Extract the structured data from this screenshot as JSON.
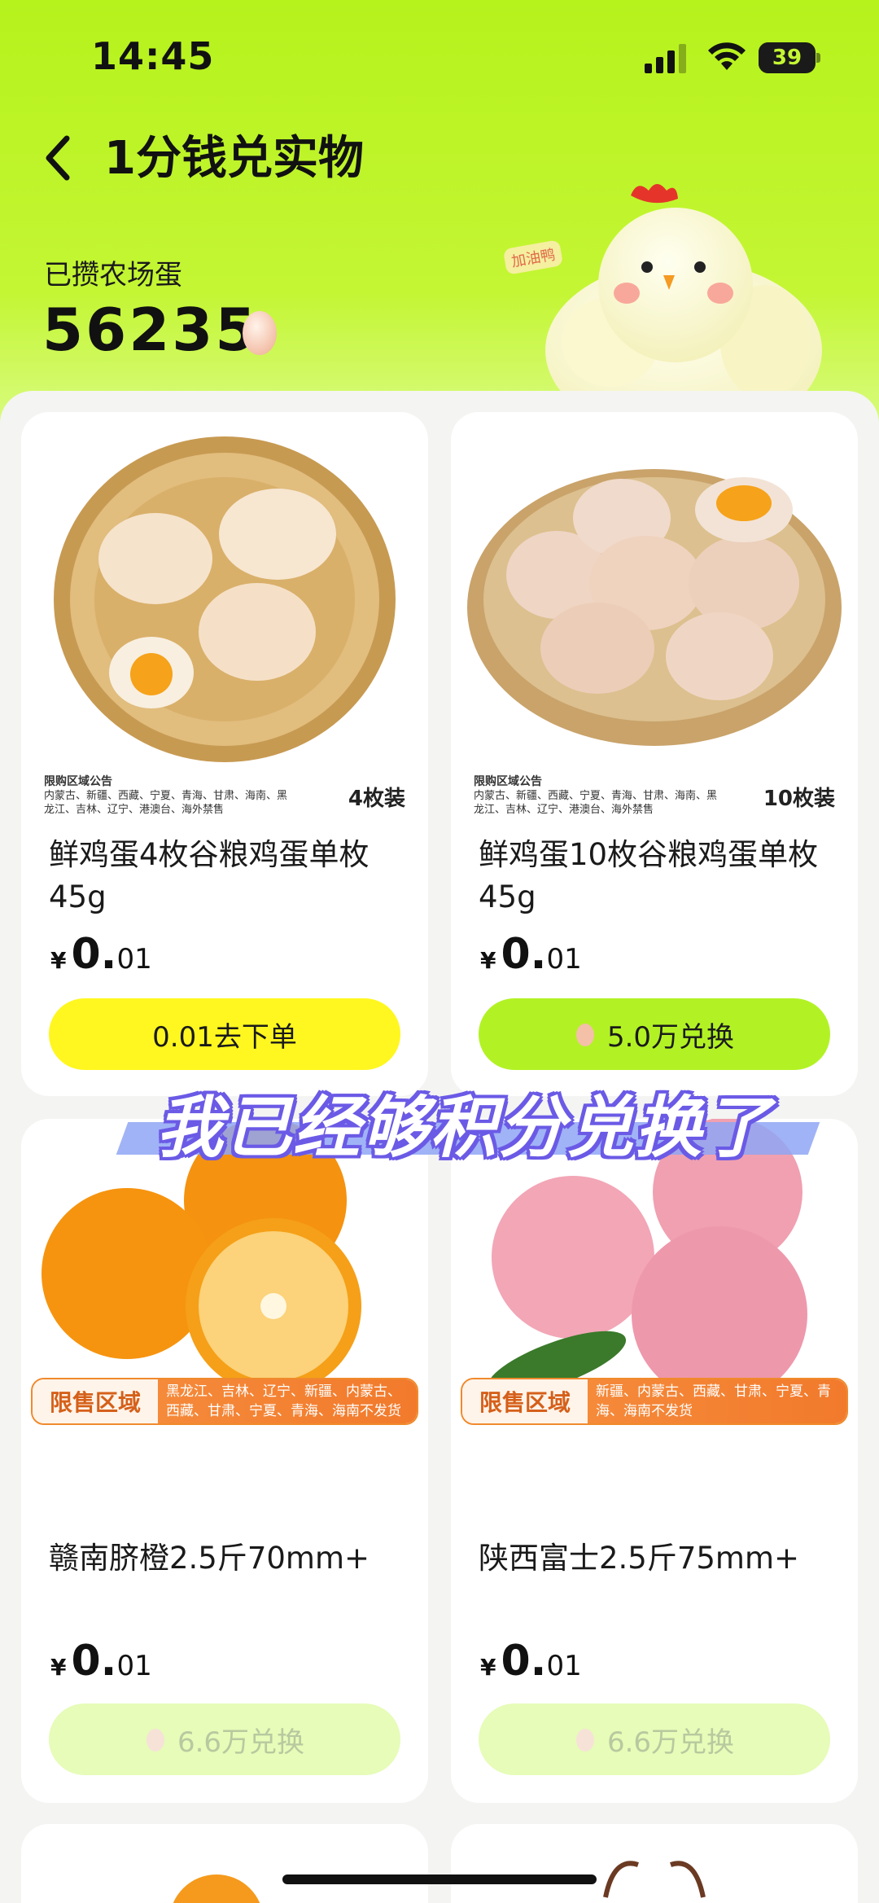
{
  "status_bar": {
    "time": "14:45",
    "battery": "39"
  },
  "header": {
    "title": "1分钱兑实物",
    "points_label": "已攒农场蛋",
    "points_value": "56235",
    "mascot_badge": "加油鸭"
  },
  "caption": "我已经够积分兑换了",
  "products": [
    {
      "name": "鲜鸡蛋4枚谷粮鸡蛋单枚45g",
      "price_symbol": "¥",
      "price_int": "0",
      "price_dot": ".",
      "price_dec": "01",
      "button": "0.01去下单",
      "pack": "4枚装",
      "notice_title": "限购区域公告",
      "notice_text": "内蒙古、新疆、西藏、宁夏、青海、甘肃、海南、黑龙江、吉林、辽宁、港澳台、海外禁售"
    },
    {
      "name": "鲜鸡蛋10枚谷粮鸡蛋单枚45g",
      "price_symbol": "¥",
      "price_int": "0",
      "price_dot": ".",
      "price_dec": "01",
      "button": "5.0万兑换",
      "pack": "10枚装",
      "notice_title": "限购区域公告",
      "notice_text": "内蒙古、新疆、西藏、宁夏、青海、甘肃、海南、黑龙江、吉林、辽宁、港澳台、海外禁售"
    },
    {
      "name": "赣南脐橙2.5斤70mm+",
      "price_symbol": "¥",
      "price_int": "0",
      "price_dot": ".",
      "price_dec": "01",
      "button": "6.6万兑换",
      "region_label": "限售区域",
      "region_text": "黑龙江、吉林、辽宁、新疆、内蒙古、西藏、甘肃、宁夏、青海、海南不发货"
    },
    {
      "name": "陕西富士2.5斤75mm+",
      "price_symbol": "¥",
      "price_int": "0",
      "price_dot": ".",
      "price_dec": "01",
      "button": "6.6万兑换",
      "region_label": "限售区域",
      "region_text": "新疆、内蒙古、西藏、甘肃、宁夏、青海、海南不发货"
    }
  ],
  "colors": {
    "accent_green": "#b2f224",
    "accent_yellow": "#fff71f",
    "region_orange": "#f27a2c"
  },
  "icons": [
    "back-chevron-icon",
    "signal-icon",
    "wifi-icon",
    "battery-icon",
    "egg-icon"
  ]
}
